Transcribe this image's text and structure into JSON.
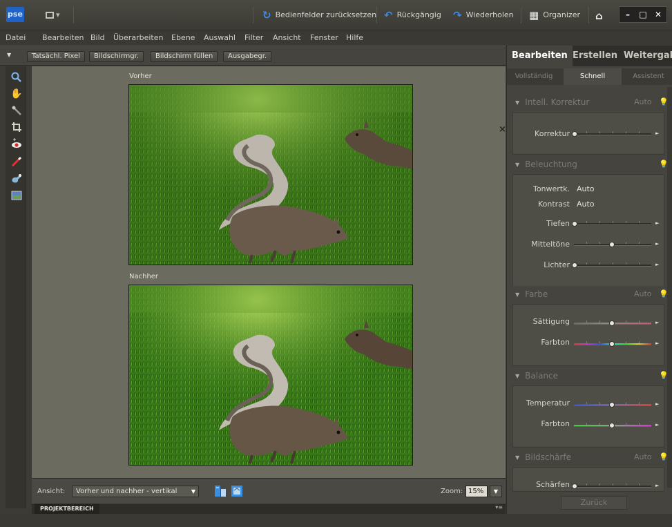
{
  "app": {
    "logo": "pse"
  },
  "titlebar": {
    "layout_arrow": "▾",
    "reset_panels": "Bedienfelder zurücksetzen",
    "undo": "Rückgängig",
    "redo": "Wiederholen",
    "organizer": "Organizer",
    "icons": {
      "reset": "refresh-icon",
      "undo": "undo-icon",
      "redo": "redo-icon",
      "organizer": "organizer-grid-icon",
      "home": "home-icon"
    }
  },
  "menu": [
    "Datei",
    "Bearbeiten",
    "Bild",
    "Überarbeiten",
    "Ebene",
    "Auswahl",
    "Filter",
    "Ansicht",
    "Fenster",
    "Hilfe"
  ],
  "options": {
    "buttons": [
      "Tatsächl. Pixel",
      "Bildschirmgr.",
      "Bildschirm füllen",
      "Ausgabegr."
    ]
  },
  "tools": [
    "zoom-tool-icon",
    "hand-tool-icon",
    "quick-selection-tool-icon",
    "crop-tool-icon",
    "red-eye-tool-icon",
    "whiten-teeth-tool-icon",
    "blue-sky-tool-icon",
    "black-white-tool-icon"
  ],
  "workspace": {
    "before_label": "Vorher",
    "after_label": "Nachher",
    "close": "×"
  },
  "bottombar": {
    "view_label": "Ansicht:",
    "view_value": "Vorher und nachher - vertikal",
    "zoom_label": "Zoom:",
    "zoom_value": "15%"
  },
  "project_bin": {
    "label": "PROJEKTBEREICH"
  },
  "panel": {
    "tabs": [
      "Bearbeiten",
      "Erstellen",
      "Weitergabe"
    ],
    "subtabs": [
      "Vollständig",
      "Schnell",
      "Assistent"
    ],
    "sections": {
      "smart_fix": {
        "title": "Intell. Korrektur",
        "auto": "Auto",
        "label": "Korrektur"
      },
      "lighting": {
        "title": "Beleuchtung",
        "levels_label": "Tonwertk.",
        "levels_btn": "Auto",
        "contrast_label": "Kontrast",
        "contrast_btn": "Auto",
        "shadows": "Tiefen",
        "midtones": "Mitteltöne",
        "highlights": "Lichter"
      },
      "color": {
        "title": "Farbe",
        "auto": "Auto",
        "saturation": "Sättigung",
        "hue": "Farbton"
      },
      "balance": {
        "title": "Balance",
        "temperature": "Temperatur",
        "tint": "Farbton"
      },
      "sharpness": {
        "title": "Bildschärfe",
        "auto": "Auto",
        "sharpen": "Schärfen"
      }
    },
    "back_button": "Zurück"
  }
}
